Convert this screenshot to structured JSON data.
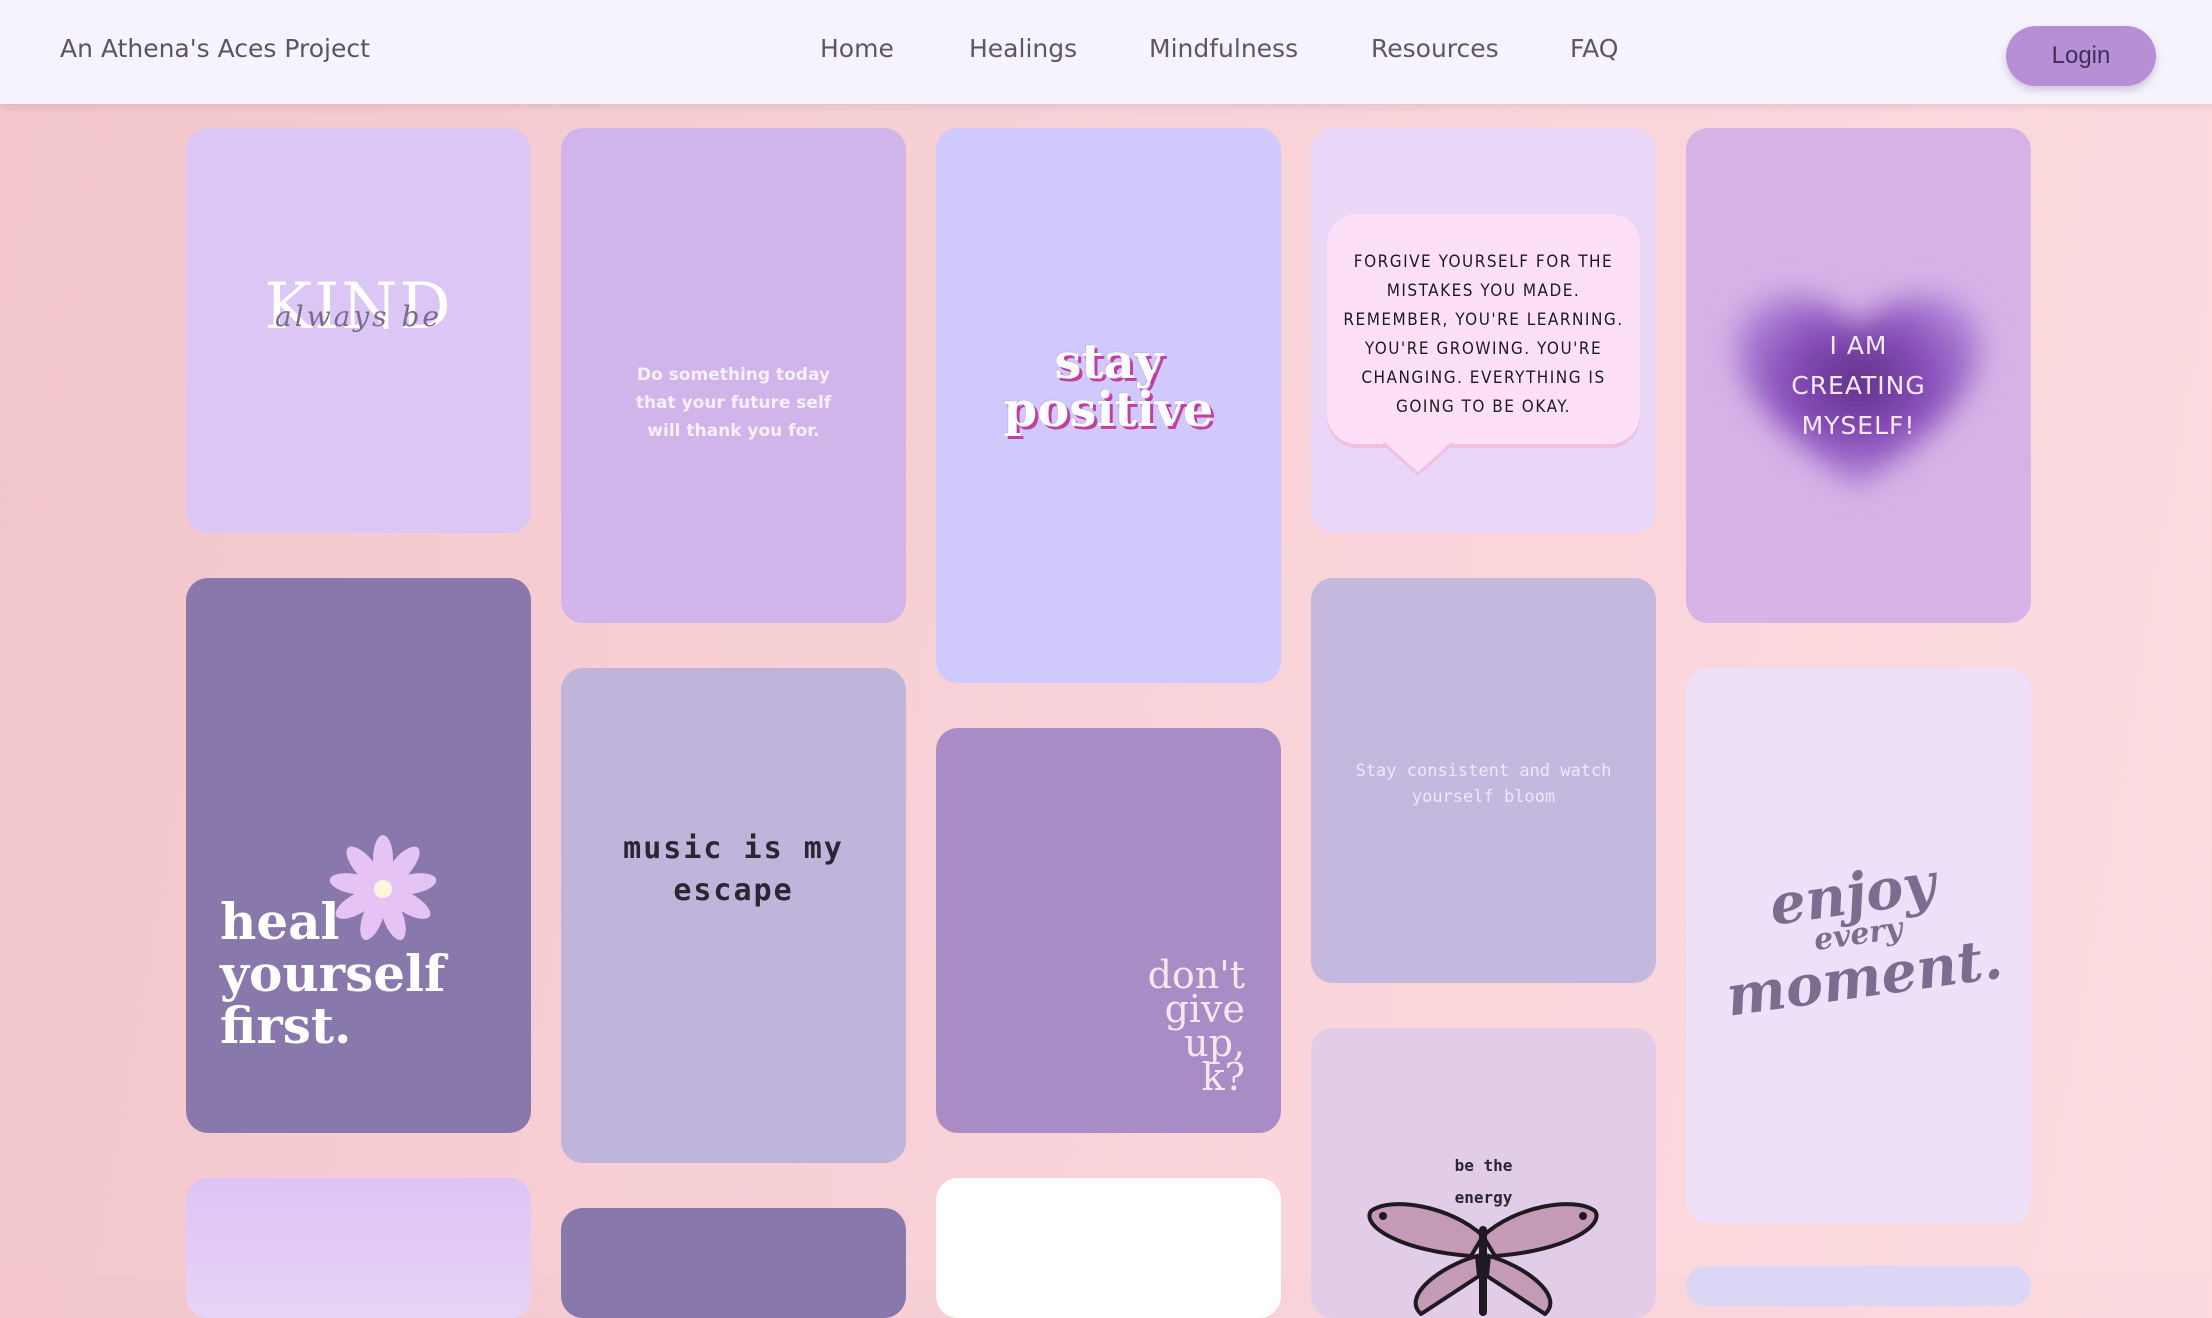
{
  "navbar": {
    "brand": "An Athena's Aces Project",
    "links": [
      "Home",
      "Healings",
      "Mindfulness",
      "Resources",
      "FAQ"
    ],
    "login": "Login"
  },
  "cards": {
    "kind": {
      "small": "always be",
      "big": "KIND"
    },
    "future": {
      "l1": "Do something today",
      "l2": "that your future self",
      "l3": "will thank you for."
    },
    "stay": {
      "l1": "stay",
      "l2": "positive"
    },
    "forgive": {
      "l1": "FORGIVE YOURSELF FOR THE",
      "l2": "MISTAKES YOU MADE.",
      "l3": "REMEMBER, YOU'RE LEARNING.",
      "l4": "YOU'RE GROWING. YOU'RE",
      "l5": "CHANGING. EVERYTHING IS",
      "l6": "GOING TO BE OKAY."
    },
    "creating": {
      "l1": "I AM",
      "l2": "CREATING",
      "l3": "MYSELF!"
    },
    "heal": {
      "l1": "heal",
      "l2": "yourself",
      "l3": "first."
    },
    "music": {
      "l1": "music is my",
      "l2": "escape"
    },
    "dontgive": {
      "l1": "don't",
      "l2": "give",
      "l3": "up,",
      "l4": "k?"
    },
    "bloom": {
      "l1": "Stay consistent and watch",
      "l2": "yourself bloom"
    },
    "enjoy": {
      "l1": "enjoy",
      "l2": "every",
      "l3": "moment."
    },
    "energy": {
      "l1": "be the",
      "l2": "energy"
    }
  }
}
